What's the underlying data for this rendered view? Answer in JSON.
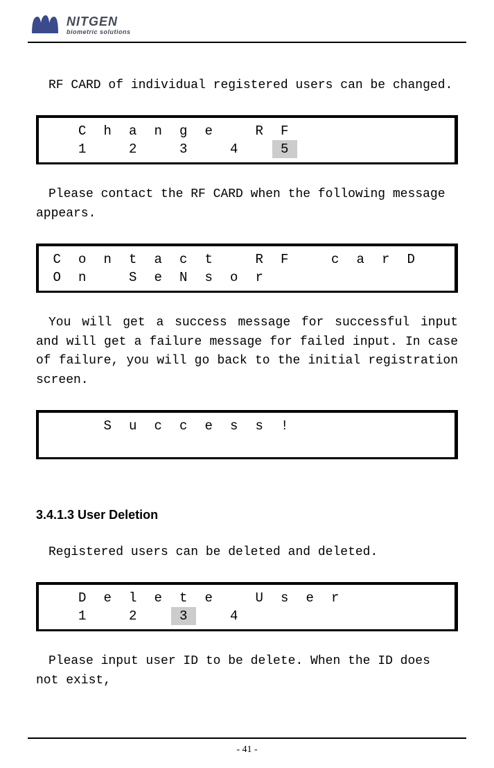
{
  "logo": {
    "title": "NITGEN",
    "subtitle": "biometric solutions"
  },
  "para1": "RF CARD of individual registered users can be changed.",
  "lcd1": {
    "row1": [
      " ",
      "C",
      "h",
      "a",
      "n",
      "g",
      "e",
      " ",
      "R",
      "F",
      " ",
      " ",
      " ",
      " ",
      " ",
      " "
    ],
    "row2": [
      " ",
      "1",
      " ",
      "2",
      " ",
      "3",
      " ",
      "4",
      " ",
      "5",
      " ",
      " ",
      " ",
      " ",
      " ",
      " "
    ],
    "highlight": {
      "row": 1,
      "col": 9
    }
  },
  "para2": "Please contact the RF CARD when the following message appears.",
  "lcd2": {
    "row1": [
      "C",
      "o",
      "n",
      "t",
      "a",
      "c",
      "t",
      " ",
      "R",
      "F",
      " ",
      "c",
      "a",
      "r",
      "D",
      " "
    ],
    "row2": [
      "O",
      "n",
      " ",
      "S",
      "e",
      "N",
      "s",
      "o",
      "r",
      " ",
      " ",
      " ",
      " ",
      " ",
      " ",
      " "
    ]
  },
  "para3": "You will get a success message for successful input and will get a failure message for failed input. In case of failure, you will go back to the initial registration screen.",
  "lcd3": {
    "row1": [
      " ",
      " ",
      "S",
      "u",
      "c",
      "c",
      "e",
      "s",
      "s",
      "!",
      " ",
      " ",
      " ",
      " ",
      " ",
      " "
    ],
    "row2": [
      " ",
      " ",
      " ",
      " ",
      " ",
      " ",
      " ",
      " ",
      " ",
      " ",
      " ",
      " ",
      " ",
      " ",
      " ",
      " "
    ]
  },
  "section": "3.4.1.3 User Deletion",
  "para4": "Registered users can be deleted and deleted.",
  "lcd4": {
    "row1": [
      " ",
      "D",
      "e",
      "l",
      "e",
      "t",
      "e",
      " ",
      "U",
      "s",
      "e",
      "r",
      " ",
      " ",
      " ",
      " "
    ],
    "row2": [
      " ",
      "1",
      " ",
      "2",
      " ",
      "3",
      " ",
      "4",
      " ",
      " ",
      " ",
      " ",
      " ",
      " ",
      " ",
      " "
    ],
    "highlight": {
      "row": 1,
      "col": 5
    }
  },
  "para5": "Please input user ID to be delete. When the ID does not exist,",
  "pageNumber": "- 41 -"
}
